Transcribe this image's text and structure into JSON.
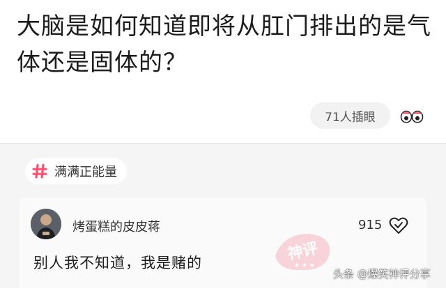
{
  "question": {
    "title": "大脑是如何知道即将从肛门排出的是气体还是固体的？",
    "poke_label": "71人插眼",
    "eyes_icon": "eyes-icon"
  },
  "tag": {
    "label": "满满正能量",
    "icon": "hash-icon",
    "accent": "#ff4d6d"
  },
  "comment": {
    "author": "烤蛋糕的皮皮蒋",
    "likes": "915",
    "text": "别人我不知道，我是赌的",
    "stamp_text": "神评"
  },
  "watermark": {
    "text": "头条 @爆笑神评分享"
  }
}
